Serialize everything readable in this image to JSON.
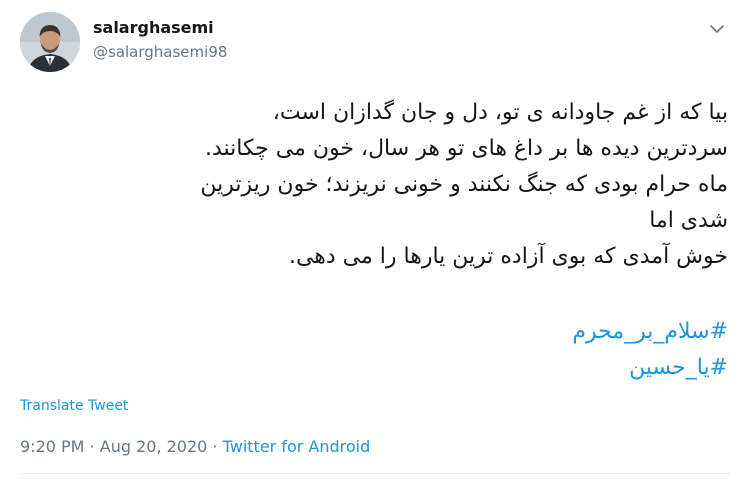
{
  "author": {
    "display_name": "salarghasemi",
    "handle": "@salarghasemi98"
  },
  "tweet": {
    "lines": [
      "بیا که از غم جاودانه ی تو، دل و جان گدازان است،",
      "سردترین دیده ها بر داغ های تو هر سال، خون می چکانند.",
      "ماه حرام بودی که جنگ نکنند و خونی نریزند؛ خون ریزترین",
      "شدی اما",
      "خوش آمدی که بوی آزاده ترین یارها را می دهی."
    ],
    "hashtags": [
      "#سلام_بر_محرم",
      "#یا_حسین"
    ]
  },
  "translate_label": "Translate Tweet",
  "meta": {
    "time": "9:20 PM",
    "separator": "·",
    "date": "Aug 20, 2020",
    "source": "Twitter for Android"
  },
  "icons": {
    "menu": "chevron-down-icon"
  },
  "colors": {
    "link": "#1b95e0",
    "secondary": "#657786",
    "text": "#14171a"
  }
}
